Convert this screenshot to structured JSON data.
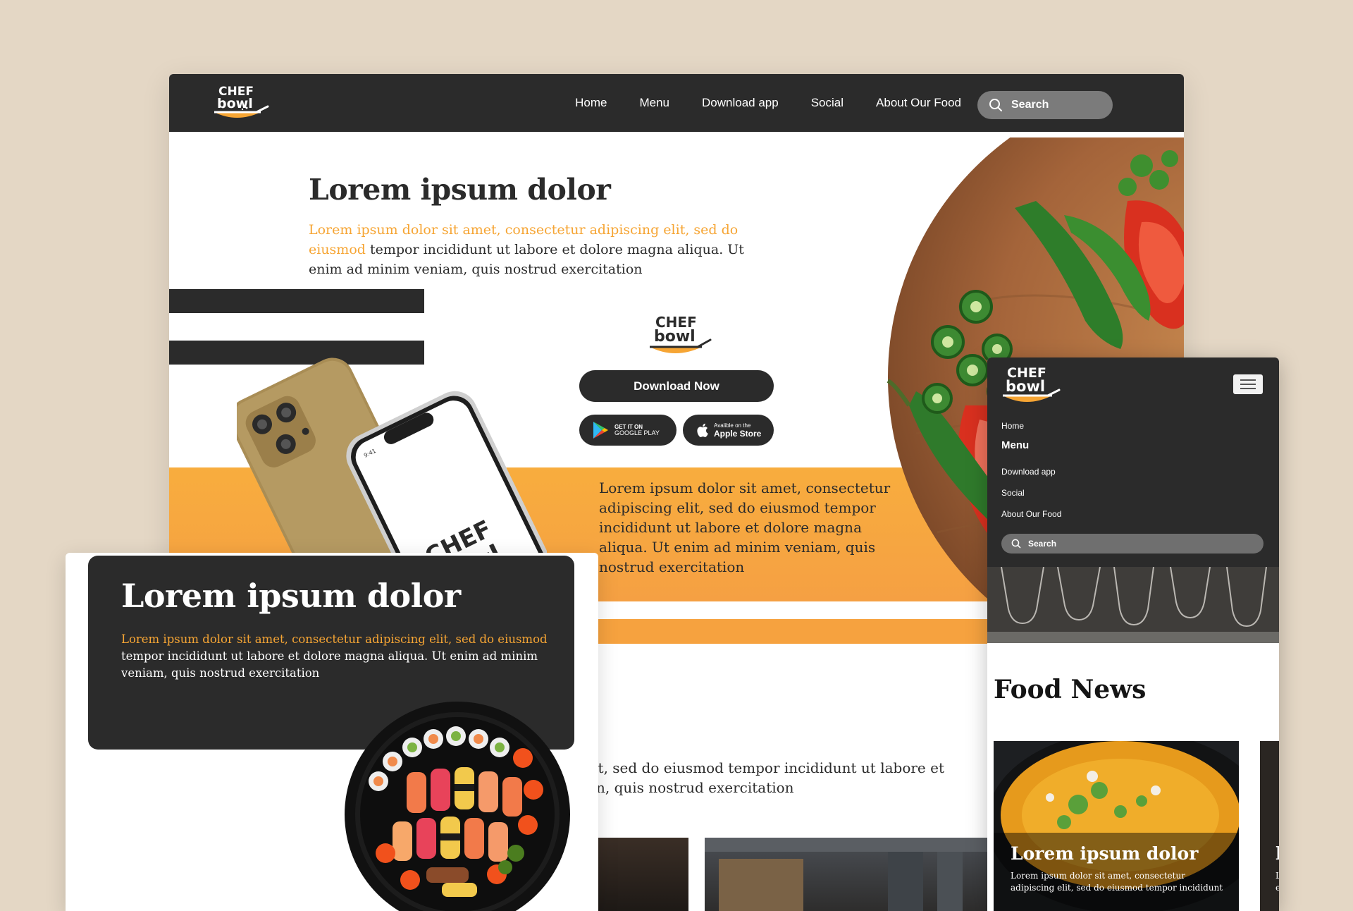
{
  "brand": {
    "logo_line1": "CHEF",
    "logo_line2": "bowl"
  },
  "desktop": {
    "nav": {
      "links": [
        "Home",
        "Menu",
        "Download app",
        "Social",
        "About Our Food"
      ],
      "search_label": "Search"
    },
    "hero": {
      "title": "Lorem ipsum dolor",
      "text_accent": "Lorem ipsum dolor sit amet, consectetur adipiscing elit, sed do eiusmod",
      "text_rest": "tempor incididunt ut labore et dolore magna aliqua. Ut enim ad minim veniam, quis nostrud exercitation"
    },
    "download": {
      "button_label": "Download Now",
      "google_small": "GET IT ON",
      "google_big": "GOOGLE PLAY",
      "apple_small": "Avalible on the",
      "apple_big": "Apple Store"
    },
    "phone": {
      "time": "9:41"
    },
    "band_text": "Lorem ipsum dolor sit amet, consectetur adipiscing elit, sed do eiusmod tempor incididunt ut labore et dolore magna aliqua. Ut enim ad minim veniam, quis nostrud exercitation",
    "lower_text_line1": "cing elit, sed do eiusmod tempor incididunt ut labore et",
    "lower_text_line2": "n, quis nostrud exercitation"
  },
  "mobile": {
    "menu": [
      "Home",
      "Menu",
      "Download app",
      "Social",
      "About Our Food"
    ],
    "search_label": "Search",
    "section_title": "Food News",
    "card": {
      "title": "Lorem ipsum dolor",
      "text": "Lorem ipsum dolor sit amet, consectetur adipiscing elit, sed do eiusmod tempor incididunt",
      "second_title_fragment": "l",
      "second_text_fragment": "L e"
    }
  },
  "tablet": {
    "title": "Lorem ipsum dolor",
    "text_accent": "Lorem ipsum dolor sit amet, consectetur adipiscing elit, sed do eiusmod",
    "text_rest": "tempor incididunt ut labore et dolore magna aliqua. Ut enim ad minim veniam, quis nostrud exercitation"
  },
  "colors": {
    "dark": "#2b2b2b",
    "accent": "#f6a534",
    "background": "#e4d7c5"
  }
}
